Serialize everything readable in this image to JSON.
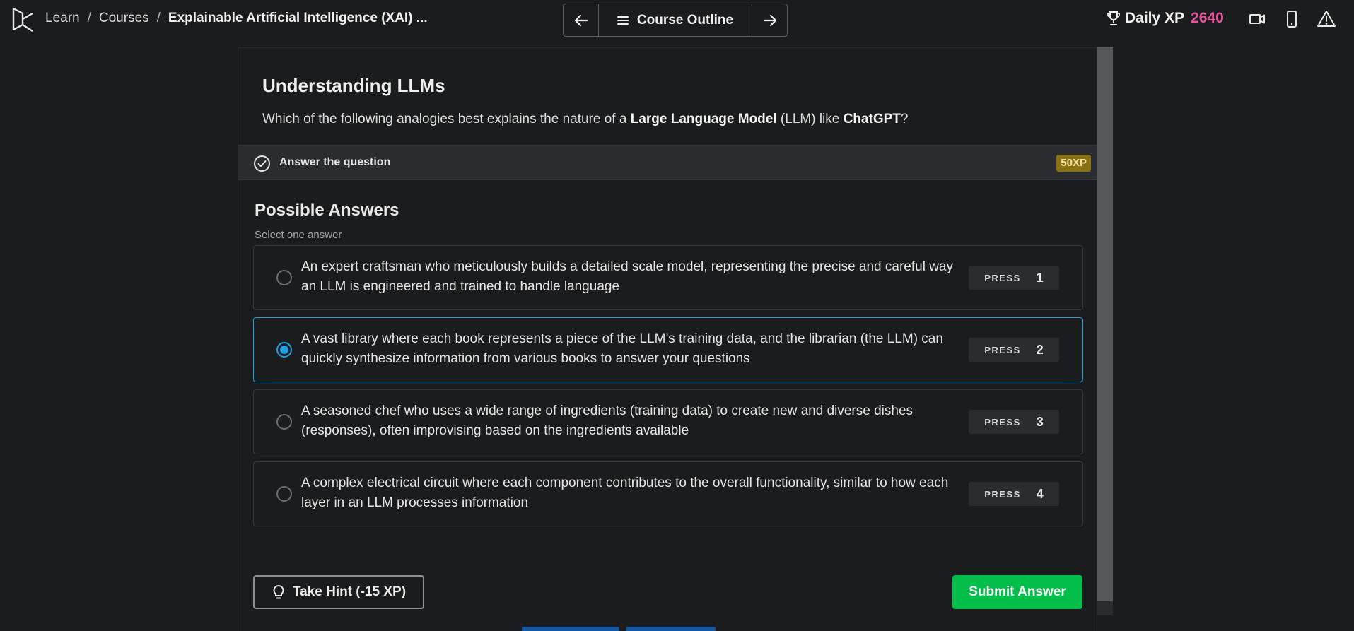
{
  "header": {
    "breadcrumb": [
      "Learn",
      "Courses",
      "Explainable Artificial Intelligence (XAI) ..."
    ],
    "separator": "/",
    "course_outline_label": "Course Outline",
    "daily_xp_label": "Daily XP",
    "daily_xp_value": "2640",
    "icons": [
      "datacamp-logo-icon",
      "arrow-left-icon",
      "menu-icon",
      "arrow-right-icon",
      "trophy-icon",
      "video-icon",
      "mobile-icon",
      "alert-icon"
    ]
  },
  "exercise": {
    "title": "Understanding LLMs",
    "question_prefix": "Which of the following analogies best explains the nature of a ",
    "question_bold_1": "Large Language Model",
    "question_mid": " (LLM) like ",
    "question_bold_2": "ChatGPT",
    "question_suffix": "?"
  },
  "instruction": {
    "text": "Answer the question",
    "xp_badge": "50XP"
  },
  "answers": {
    "title": "Possible Answers",
    "subtitle": "Select one answer",
    "press_label": "PRESS",
    "selected_index": 2,
    "options": [
      {
        "key": "1",
        "text": "An expert craftsman who meticulously builds a detailed scale model, representing the precise and careful way an LLM is engineered and trained to handle language"
      },
      {
        "key": "2",
        "text": "A vast library where each book represents a piece of the LLM’s training data, and the librarian (the LLM) can quickly synthesize information from various books to answer your questions"
      },
      {
        "key": "3",
        "text": "A seasoned chef who uses a wide range of ingredients (training data) to create new and diverse dishes (responses), often improvising based on the ingredients available"
      },
      {
        "key": "4",
        "text": "A complex electrical circuit where each component contributes to the overall functionality, similar to how each layer in an LLM processes information"
      }
    ]
  },
  "actions": {
    "hint_label": "Take Hint (-15 XP)",
    "submit_label": "Submit Answer"
  },
  "colors": {
    "accent_blue": "#1ba1e6",
    "submit_green": "#03bf4a",
    "xp_pink": "#e3559a",
    "xp_badge_gold": "#8a7212"
  }
}
